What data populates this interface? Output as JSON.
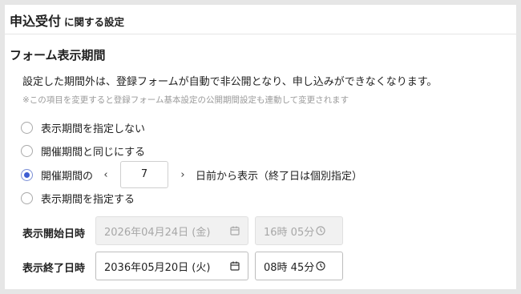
{
  "header": {
    "title_main": "申込受付",
    "title_sub": "に関する設定"
  },
  "section": {
    "title": "フォーム表示期間",
    "description": "設定した期間外は、登録フォームが自動で非公開となり、申し込みができなくなります。",
    "note": "※この項目を変更すると登録フォーム基本設定の公開期間設定も連動して変更されます"
  },
  "options": {
    "no_period": "表示期間を指定しない",
    "same_as_event": "開催期間と同じにする",
    "relative_prefix": "開催期間の",
    "relative_days": "7",
    "relative_suffix": "日前から表示（終了日は個別指定）",
    "specify_period": "表示期間を指定する",
    "selected": "relative"
  },
  "start": {
    "label": "表示開始日時",
    "date": "2026年04月24日 (金)",
    "time": "16時 05分",
    "disabled": true
  },
  "end": {
    "label": "表示終了日時",
    "date": "2036年05月20日 (火)",
    "time": "08時 45分",
    "disabled": false
  },
  "icons": {
    "calendar": "calendar-icon",
    "clock": "clock-icon",
    "prev": "chevron-left-icon",
    "next": "chevron-right-icon"
  },
  "colors": {
    "accent": "#3f5ed2",
    "note": "#9a9a9a",
    "disabled_bg": "#f1f1f1"
  }
}
